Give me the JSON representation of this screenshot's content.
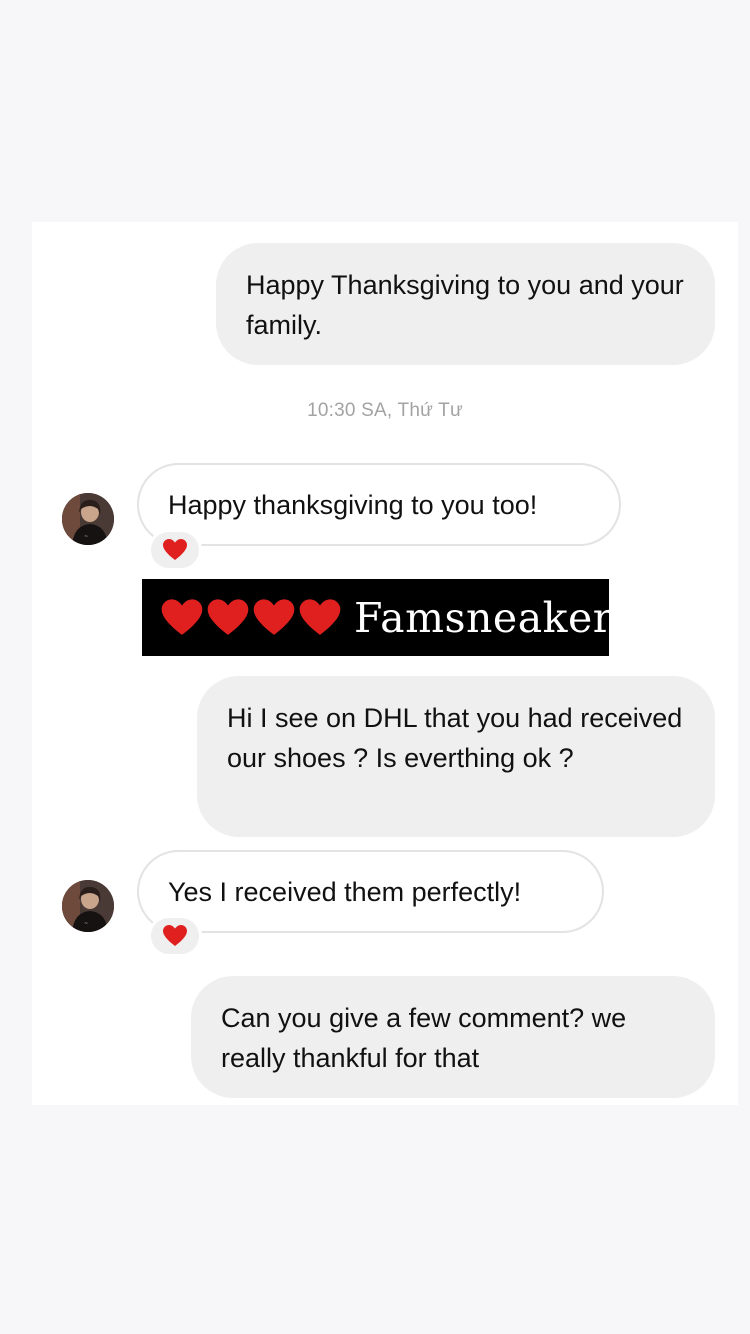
{
  "messages": {
    "m1": "Happy Thanksgiving to you and your family.",
    "timestamp": "10:30 SA, Thứ Tư",
    "m2": "Happy thanksgiving to you too!",
    "m3": "Hi I see on DHL that you had received our shoes ? Is everthing ok ?",
    "m4": "Yes I received them perfectly!",
    "m5": "Can you give a few comment? we really thankful for that"
  },
  "banner": {
    "text": "Famsneaker"
  },
  "icons": {
    "reaction": "heart-icon",
    "avatar": "contact-avatar"
  },
  "colors": {
    "page_background": "#f7f7fa",
    "outgoing_bubble": "#efefef",
    "incoming_border": "#e3e3e3",
    "heart": "#e0201f",
    "timestamp": "#a3a3a3",
    "banner_background": "#000000"
  }
}
